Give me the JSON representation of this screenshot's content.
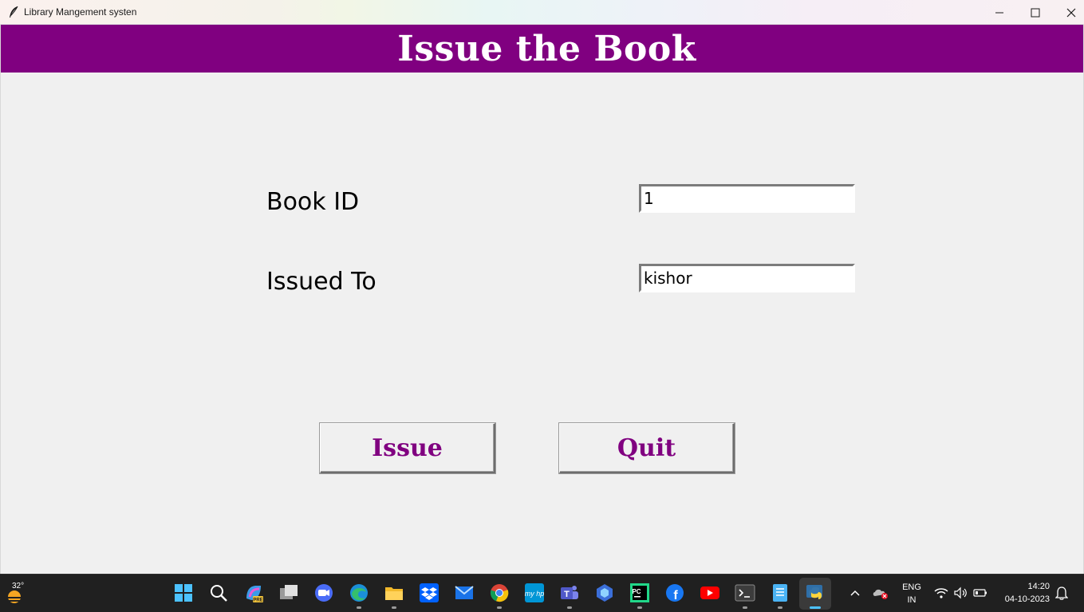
{
  "window": {
    "title": "Library Mangement systen",
    "minimize_icon": "minimize-icon",
    "maximize_icon": "maximize-icon",
    "close_icon": "close-icon"
  },
  "colors": {
    "banner": "#800080",
    "button_text": "#800080",
    "background": "#f0f0f0"
  },
  "heading": "Issue the Book",
  "form": {
    "book_id_label": "Book ID",
    "book_id_value": "1",
    "issued_to_label": "Issued To",
    "issued_to_value": "kishor"
  },
  "buttons": {
    "issue_label": "Issue",
    "quit_label": "Quit"
  },
  "taskbar": {
    "weather_temp": "32°",
    "apps": [
      "start-icon",
      "search-icon",
      "copilot-icon",
      "task-view-icon",
      "zoom-icon",
      "edge-icon",
      "file-explorer-icon",
      "dropbox-icon",
      "mail-icon",
      "chrome-icon",
      "myhp-icon",
      "teams-icon",
      "photos-icon",
      "pycharm-icon",
      "facebook-icon",
      "youtube-icon",
      "terminal-icon",
      "notepad-icon",
      "python-icon"
    ],
    "language_line1": "ENG",
    "language_line2": "IN",
    "time": "14:20",
    "date": "04-10-2023"
  }
}
